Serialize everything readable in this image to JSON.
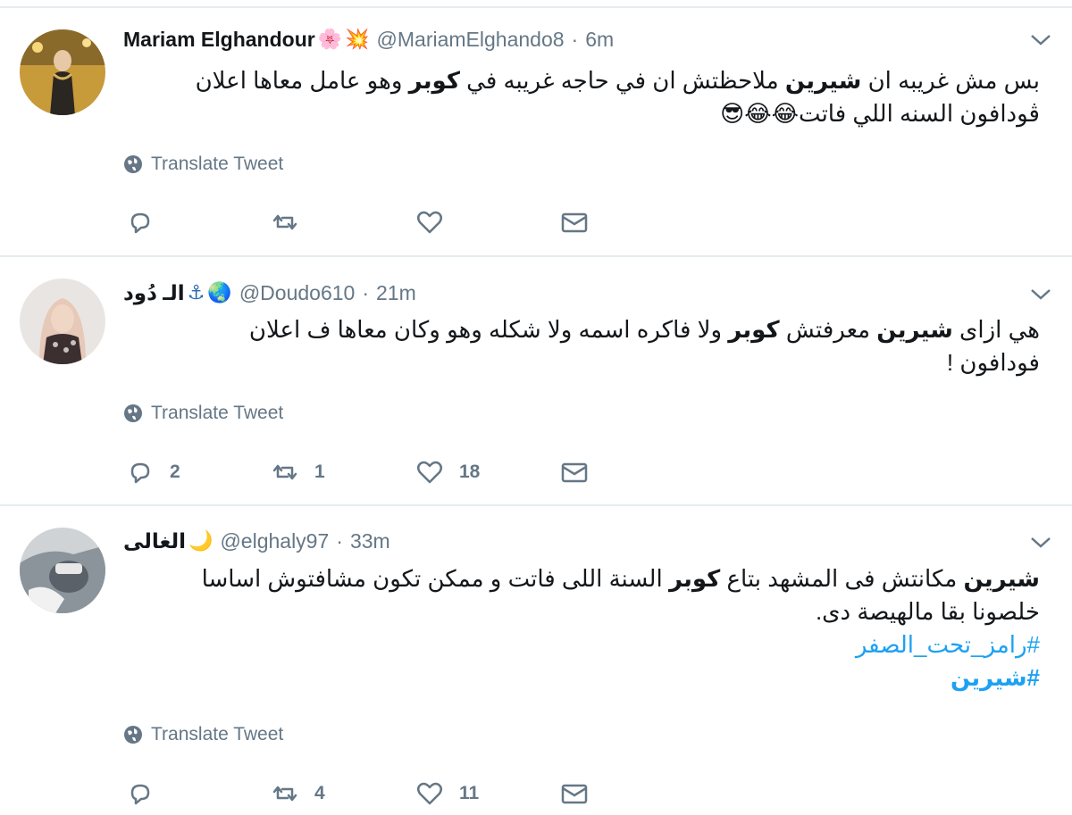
{
  "tweets": [
    {
      "name": "Mariam Elghandour",
      "badges": [
        "🌸",
        "💥"
      ],
      "handle": "@MariamElghando8",
      "time": "6m",
      "line1": {
        "a": "بس مش غريبه ان ",
        "b1": "شيرين",
        "c": " ملاحظتش ان في حاجه غريبه في ",
        "b2": "كوبر",
        "d": " وهو عامل معاها اعلان"
      },
      "line2": "ڤودافون السنه اللي فاتت😂😂😎",
      "translate": "Translate Tweet",
      "counts": {
        "reply": "",
        "retweet": "",
        "like": ""
      }
    },
    {
      "name": "الـ دُود",
      "badges": [
        "⚓",
        "🌏"
      ],
      "handle": "@Doudo610",
      "time": "21m",
      "line1": {
        "a": "هي ازاى ",
        "b1": "شيرين",
        "c": " معرفتش ",
        "b2": "كوبر",
        "d": " ولا فاكره اسمه ولا شكله وهو وكان معاها ف اعلان"
      },
      "line2": "فودافون !",
      "translate": "Translate Tweet",
      "counts": {
        "reply": "2",
        "retweet": "1",
        "like": "18"
      }
    },
    {
      "name": "الغالى",
      "badges": [
        "🌙"
      ],
      "handle": "@elghaly97",
      "time": "33m",
      "line1": {
        "a": "",
        "b1": "شيرين",
        "c": " مكانتش فى المشهد بتاع ",
        "b2": "كوبر",
        "d": " السنة اللى فاتت و ممكن تكون مشافتوش اساسا"
      },
      "line2": "خلصونا بقا مالهيصة دى.",
      "hashtag1": "#رامز_تحت_الصفر",
      "hashtag2": "#شيرين",
      "translate": "Translate Tweet",
      "counts": {
        "reply": "",
        "retweet": "4",
        "like": "11"
      }
    }
  ],
  "icons": {
    "reply": "reply-icon",
    "retweet": "retweet-icon",
    "like": "heart-icon",
    "dm": "envelope-icon",
    "globe": "globe-icon",
    "caret": "chevron-down-icon"
  },
  "colors": {
    "secondary": "#657786",
    "link": "#1da1f2",
    "border": "#e6ecf0"
  }
}
